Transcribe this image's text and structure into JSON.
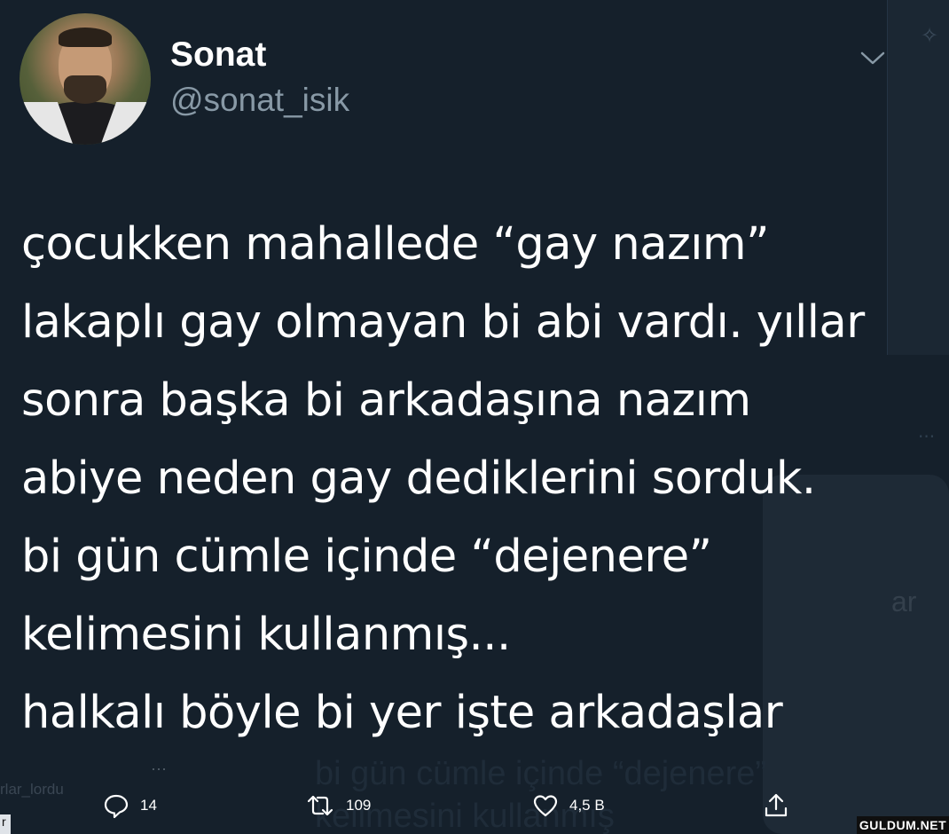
{
  "user": {
    "display_name": "Sonat",
    "handle": "@sonat_isik"
  },
  "tweet": {
    "lines": [
      "çocukken mahallede “gay nazım”",
      "lakaplı gay olmayan bi abi vardı. yıllar",
      "sonra başka bi arkadaşına nazım",
      "abiye neden gay dediklerini sorduk.",
      "bi gün cümle içinde “dejenere”",
      "kelimesini kullanmış...",
      "halkalı böyle bi yer işte arkadaşlar"
    ]
  },
  "actions": {
    "reply_count": "14",
    "retweet_count": "109",
    "like_count": "4,5 B"
  },
  "background": {
    "ghost_text_1": "bi gün cümle içinde “dejenere”",
    "ghost_text_2": "kelimesini kullanmış",
    "side_text": "ar",
    "handle_fragment": "rlar_lordu",
    "edge_letter": "r"
  },
  "watermark": "GULDUM.NET",
  "colors": {
    "background": "#15202b",
    "secondary_text": "#8899a6",
    "primary_text": "#ffffff"
  }
}
